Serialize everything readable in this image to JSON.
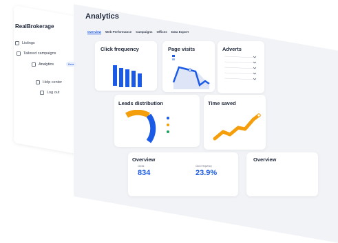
{
  "brand": "RealBrokerage",
  "sidebar": {
    "items": [
      {
        "label": "Listings"
      },
      {
        "label": "Tailored campaigns"
      },
      {
        "label": "Analytics",
        "badge": "Beta"
      },
      {
        "label": "Help center"
      },
      {
        "label": "Log out"
      }
    ]
  },
  "header": {
    "title": "Analytics"
  },
  "tabs": [
    {
      "label": "Overview"
    },
    {
      "label": "Web Performance"
    },
    {
      "label": "Campaigns"
    },
    {
      "label": "Offices"
    },
    {
      "label": "Data Export"
    }
  ],
  "cards": {
    "click_frequency": {
      "title": "Click frequency"
    },
    "page_visits": {
      "title": "Page visits"
    },
    "adverts": {
      "title": "Adverts"
    },
    "leads_distribution": {
      "title": "Leads distribution"
    },
    "time_saved": {
      "title": "Time saved"
    },
    "overview": {
      "title": "Overview",
      "clicks_label": "Clicks",
      "clicks_value": "834",
      "click_freq_label": "Click frequency",
      "click_freq_value": "23.9%"
    },
    "overview2": {
      "title": "Overview"
    }
  },
  "colors": {
    "accent": "#1a5ae6",
    "orange": "#f59e0b",
    "green": "#22a05a",
    "bg": "#f1f3f7"
  }
}
